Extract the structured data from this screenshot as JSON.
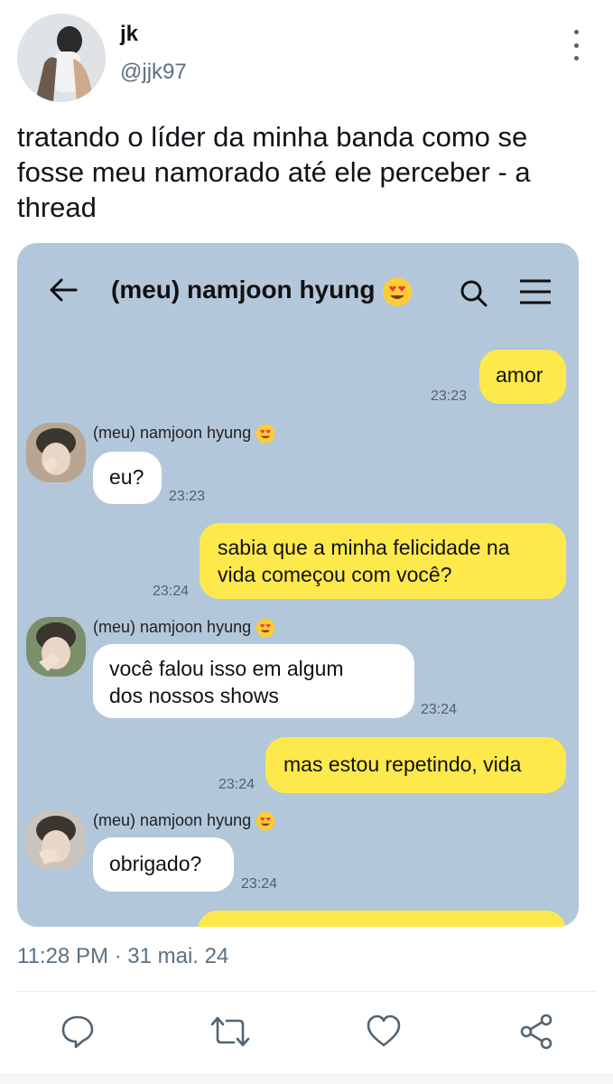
{
  "author": {
    "name": "jk",
    "handle": "@jjk97"
  },
  "tweet": {
    "text": "tratando o líder da minha banda como se fosse meu namorado até ele perceber - a thread",
    "timestamp": "11:28 PM · 31 mai. 24"
  },
  "chat": {
    "title": "(meu) namjoon hyung",
    "messages": [
      {
        "from": "me",
        "text": "amor",
        "time": "23:23"
      },
      {
        "from": "them",
        "sender": "(meu) namjoon hyung",
        "text": "eu?",
        "time": "23:23"
      },
      {
        "from": "me",
        "lines": [
          "sabia que a minha felicidade na",
          "vida começou com você?"
        ],
        "time": "23:24"
      },
      {
        "from": "them",
        "sender": "(meu) namjoon hyung",
        "lines": [
          "você falou isso em algum",
          "dos nossos shows"
        ],
        "time": "23:24"
      },
      {
        "from": "me",
        "text": "mas estou repetindo, vida",
        "time": "23:24"
      },
      {
        "from": "them",
        "sender": "(meu) namjoon hyung",
        "text": "obrigado?",
        "time": "23:24"
      }
    ]
  },
  "colors": {
    "chat_bg": "#b2c7da",
    "my_bubble": "#fde94b",
    "their_bubble": "#ffffff"
  },
  "icons": [
    "more-icon",
    "back-icon",
    "search-icon",
    "menu-icon",
    "heart-eyes-emoji",
    "reply-icon",
    "retweet-icon",
    "like-icon",
    "share-icon"
  ]
}
